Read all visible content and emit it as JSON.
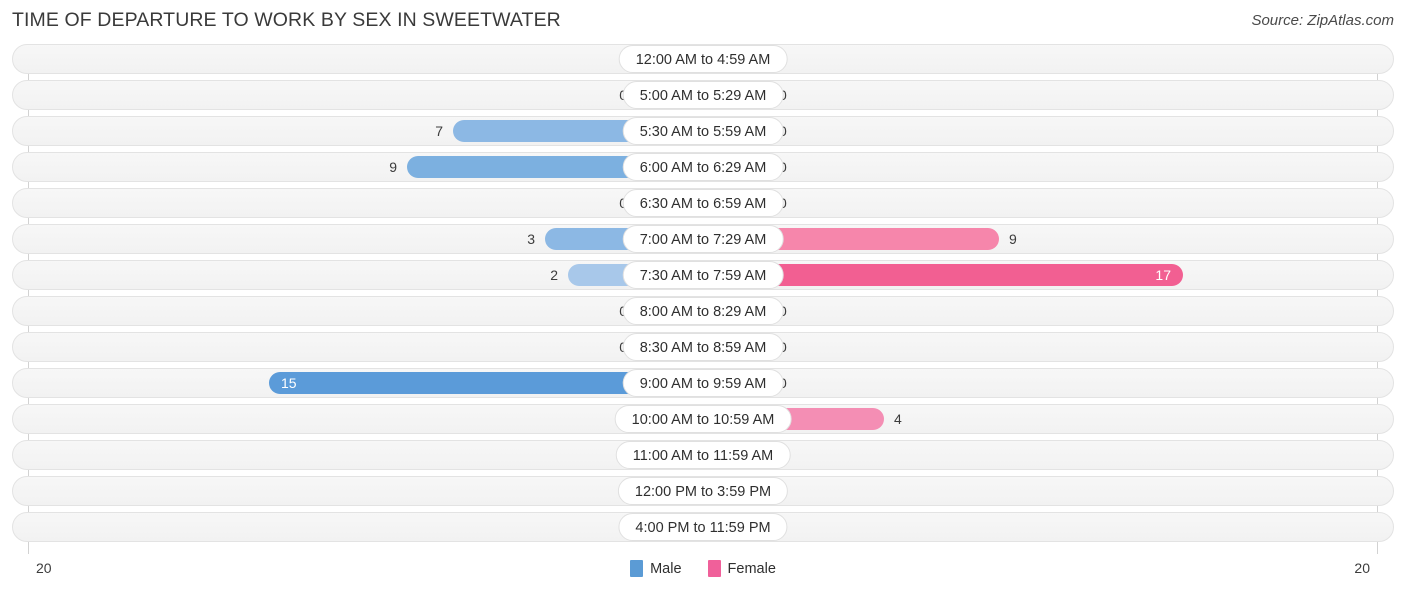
{
  "header": {
    "title": "TIME OF DEPARTURE TO WORK BY SEX IN SWEETWATER",
    "source": "Source: ZipAtlas.com"
  },
  "legend": {
    "male_label": "Male",
    "female_label": "Female",
    "male_color": "#5b9bd5",
    "female_color": "#f0609a"
  },
  "axis": {
    "left_max": "20",
    "right_max": "20"
  },
  "chart_data": {
    "type": "bar",
    "title": "TIME OF DEPARTURE TO WORK BY SEX IN SWEETWATER",
    "orientation": "horizontal-diverging",
    "xlabel": "",
    "ylabel": "",
    "xlim": [
      20,
      20
    ],
    "grid": false,
    "legend_position": "bottom-center",
    "categories": [
      "12:00 AM to 4:59 AM",
      "5:00 AM to 5:29 AM",
      "5:30 AM to 5:59 AM",
      "6:00 AM to 6:29 AM",
      "6:30 AM to 6:59 AM",
      "7:00 AM to 7:29 AM",
      "7:30 AM to 7:59 AM",
      "8:00 AM to 8:29 AM",
      "8:30 AM to 8:59 AM",
      "9:00 AM to 9:59 AM",
      "10:00 AM to 10:59 AM",
      "11:00 AM to 11:59 AM",
      "12:00 PM to 3:59 PM",
      "4:00 PM to 11:59 PM"
    ],
    "series": [
      {
        "name": "Male",
        "values": [
          0,
          0,
          7,
          9,
          0,
          3,
          2,
          0,
          0,
          15,
          0,
          0,
          0,
          0
        ]
      },
      {
        "name": "Female",
        "values": [
          0,
          0,
          0,
          0,
          0,
          9,
          17,
          0,
          0,
          0,
          4,
          0,
          0,
          0
        ]
      }
    ]
  },
  "rows": [
    {
      "label": "12:00 AM to 4:59 AM",
      "male": "0",
      "female": "0",
      "male_v": 0,
      "female_v": 0
    },
    {
      "label": "5:00 AM to 5:29 AM",
      "male": "0",
      "female": "0",
      "male_v": 0,
      "female_v": 0
    },
    {
      "label": "5:30 AM to 5:59 AM",
      "male": "7",
      "female": "0",
      "male_v": 7,
      "female_v": 0
    },
    {
      "label": "6:00 AM to 6:29 AM",
      "male": "9",
      "female": "0",
      "male_v": 9,
      "female_v": 0
    },
    {
      "label": "6:30 AM to 6:59 AM",
      "male": "0",
      "female": "0",
      "male_v": 0,
      "female_v": 0
    },
    {
      "label": "7:00 AM to 7:29 AM",
      "male": "3",
      "female": "9",
      "male_v": 3,
      "female_v": 9
    },
    {
      "label": "7:30 AM to 7:59 AM",
      "male": "2",
      "female": "17",
      "male_v": 2,
      "female_v": 17
    },
    {
      "label": "8:00 AM to 8:29 AM",
      "male": "0",
      "female": "0",
      "male_v": 0,
      "female_v": 0
    },
    {
      "label": "8:30 AM to 8:59 AM",
      "male": "0",
      "female": "0",
      "male_v": 0,
      "female_v": 0
    },
    {
      "label": "9:00 AM to 9:59 AM",
      "male": "15",
      "female": "0",
      "male_v": 15,
      "female_v": 0
    },
    {
      "label": "10:00 AM to 10:59 AM",
      "male": "0",
      "female": "4",
      "male_v": 0,
      "female_v": 4
    },
    {
      "label": "11:00 AM to 11:59 AM",
      "male": "0",
      "female": "0",
      "male_v": 0,
      "female_v": 0
    },
    {
      "label": "12:00 PM to 3:59 PM",
      "male": "0",
      "female": "0",
      "male_v": 0,
      "female_v": 0
    },
    {
      "label": "4:00 PM to 11:59 PM",
      "male": "0",
      "female": "0",
      "male_v": 0,
      "female_v": 0
    }
  ]
}
